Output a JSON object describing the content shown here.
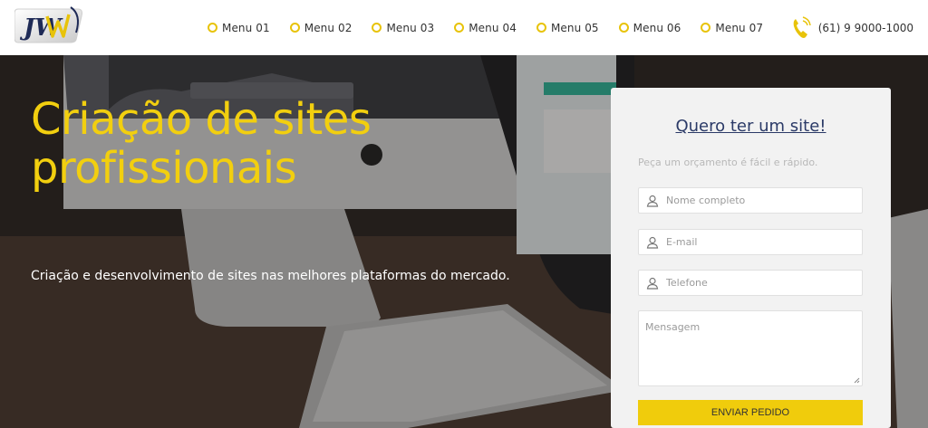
{
  "header": {
    "logo_text": "JW",
    "nav": [
      {
        "label": "Menu 01"
      },
      {
        "label": "Menu 02"
      },
      {
        "label": "Menu 03"
      },
      {
        "label": "Menu 04"
      },
      {
        "label": "Menu 05"
      },
      {
        "label": "Menu 06"
      },
      {
        "label": "Menu 07"
      }
    ],
    "phone": "(61) 9 9000-1000"
  },
  "hero": {
    "title": "Criação de sites profissionais",
    "subtitle": "Criação e desenvolvimento de sites nas melhores plataformas do mercado."
  },
  "form": {
    "title": "Quero ter um site!",
    "hint": "Peça um orçamento é fácil e rápido.",
    "name_placeholder": "Nome completo",
    "email_placeholder": "E-mail",
    "phone_placeholder": "Telefone",
    "message_placeholder": "Mensagem",
    "submit_label": "ENVIAR PEDIDO"
  },
  "colors": {
    "accent": "#f0cc0c",
    "title_blue": "#2b3a67",
    "header_bg": "#ffffff"
  },
  "icons": [
    "logo-icon",
    "circle-bullet-icon",
    "phone-icon",
    "user-icon",
    "resize-grip-icon"
  ]
}
